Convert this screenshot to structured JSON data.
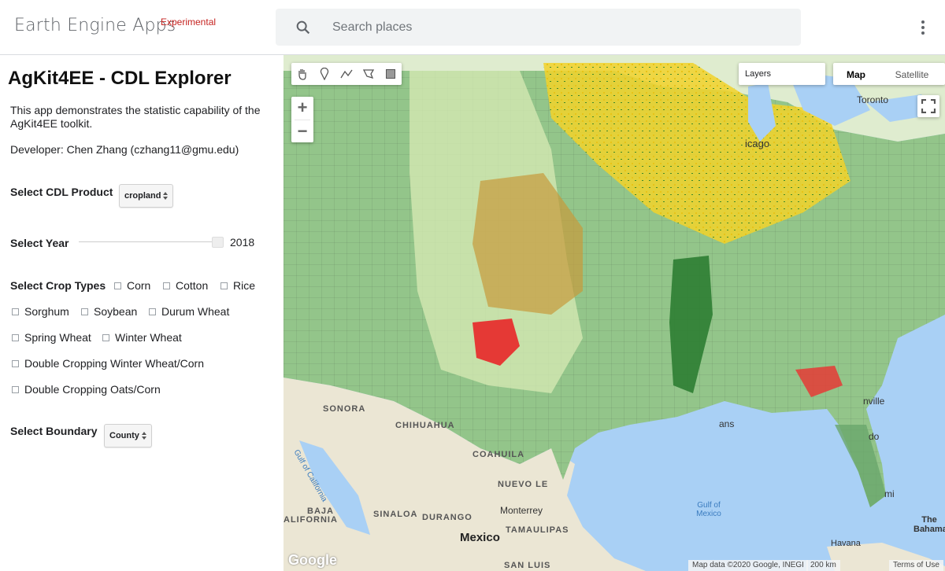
{
  "header": {
    "brand": "Earth Engine Apps",
    "badge": "Experimental",
    "search_placeholder": "Search places"
  },
  "panel": {
    "title": "AgKit4EE - CDL Explorer",
    "description": "This app demonstrates the statistic capability of the AgKit4EE toolkit.",
    "developer": "Developer: Chen Zhang (czhang11@gmu.edu)",
    "product_label": "Select CDL Product",
    "product_value": "cropland",
    "year_label": "Select Year",
    "year_value": "2018",
    "year_fraction": 1.0,
    "crop_label": "Select Crop Types",
    "crops": [
      "Corn",
      "Cotton",
      "Rice",
      "Sorghum",
      "Soybean",
      "Durum Wheat",
      "Spring Wheat",
      "Winter Wheat",
      "Double Cropping Winter Wheat/Corn",
      "Double Cropping Oats/Corn"
    ],
    "boundary_label": "Select Boundary",
    "boundary_value": "County"
  },
  "map": {
    "layers_label": "Layers",
    "map_type_options": [
      "Map",
      "Satellite"
    ],
    "selected_map_type": "Map",
    "labels": {
      "toronto": "Toronto",
      "chicago": "icago",
      "sonora": "SONORA",
      "chihuahua": "CHIHUAHUA",
      "coahuila": "COAHUILA",
      "nuevo_leon": "NUEVO LE",
      "gulf_california": "Gulf of California",
      "baja": "BAJA",
      "california": "ALIFORNIA",
      "sinaloa": "SINALOA",
      "durango": "DURANGO",
      "monterrey": "Monterrey",
      "mexico": "Mexico",
      "tamaulipas": "TAMAULIPAS",
      "san_luis": "SAN LUIS",
      "gulf_mexico": "Gulf of Mexico",
      "havana": "Havana",
      "bahamas": "The Bahamas",
      "ans": "ans",
      "nville": "nville",
      "do": "do",
      "mi": "mi"
    },
    "attribution": "Map data ©2020 Google, INEGI",
    "scale": "200 km",
    "terms": "Terms of Use",
    "google_logo": "Google"
  },
  "colors": {
    "accent": "#c5221f",
    "land": "#8fbf87",
    "water": "#a9d0f5",
    "desert": "#e9e3cf"
  }
}
